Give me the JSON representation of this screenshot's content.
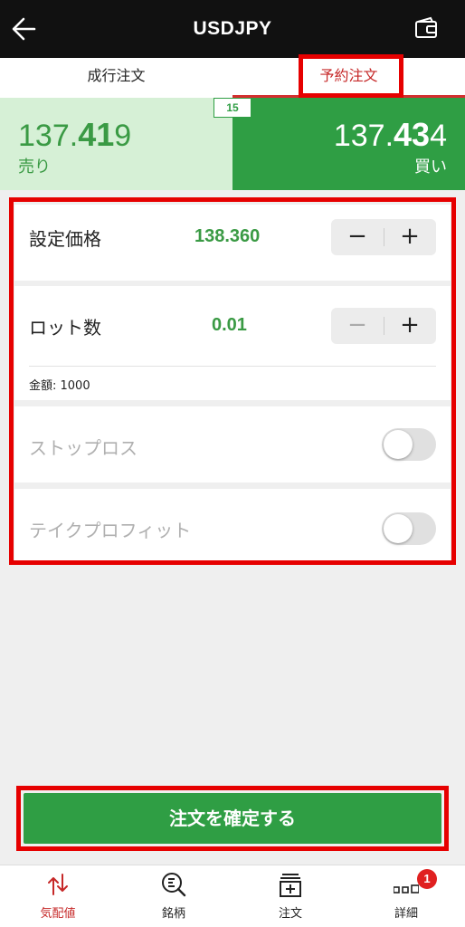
{
  "header": {
    "title": "USDJPY",
    "back_icon": "arrow-left-icon",
    "wallet_icon": "wallet-icon"
  },
  "tabs": [
    {
      "label": "成行注文",
      "active": false
    },
    {
      "label": "予約注文",
      "active": true
    }
  ],
  "prices": {
    "sell": {
      "prefix": "137.",
      "bold": "41",
      "suffix": "9",
      "label": "売り"
    },
    "buy": {
      "prefix": "137.",
      "bold": "43",
      "suffix": "4",
      "label": "買い"
    },
    "spread": "15"
  },
  "form": {
    "price": {
      "label": "設定価格",
      "value": "138.360",
      "minus": "−",
      "plus": "+"
    },
    "lot": {
      "label": "ロット数",
      "value": "0.01",
      "minus": "−",
      "plus": "+",
      "amount": "金額: 1000"
    },
    "stop_loss": {
      "label": "ストップロス",
      "enabled": false
    },
    "take_profit": {
      "label": "テイクプロフィット",
      "enabled": false
    }
  },
  "confirm_button": "注文を確定する",
  "bottom_nav": [
    {
      "label": "気配値",
      "icon": "quotes-icon",
      "active": true
    },
    {
      "label": "銘柄",
      "icon": "symbol-search-icon",
      "active": false
    },
    {
      "label": "注文",
      "icon": "order-icon",
      "active": false
    },
    {
      "label": "詳細",
      "icon": "details-icon",
      "active": false,
      "badge": "1"
    }
  ],
  "colors": {
    "accent_green": "#2f9e44",
    "accent_red": "#d32f2f",
    "highlight_box": "#e60000"
  }
}
